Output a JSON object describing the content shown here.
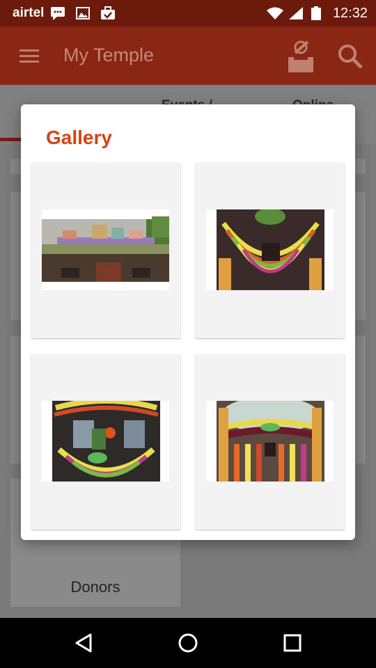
{
  "status_bar": {
    "carrier": "airtel",
    "time": "12:32",
    "icons": [
      "message-icon",
      "image-icon",
      "briefcase-check-icon",
      "wifi-icon",
      "signal-icon",
      "battery-icon"
    ]
  },
  "app_bar": {
    "title": "My Temple",
    "icons": [
      "menu-icon",
      "donation-box-icon",
      "search-icon"
    ]
  },
  "tabs": [
    "Events /",
    "Online"
  ],
  "donors": {
    "label": "Donors"
  },
  "dialog": {
    "title": "Gallery",
    "images": [
      {
        "name": "temple-exterior-photo"
      },
      {
        "name": "deity-garland-photo-1"
      },
      {
        "name": "deity-garland-photo-2"
      },
      {
        "name": "deity-garland-photo-3"
      }
    ]
  },
  "nav_bar": {
    "icons": [
      "back-icon",
      "home-icon",
      "recents-icon"
    ]
  },
  "colors": {
    "status_bar": "#6b1a0c",
    "app_bar": "#8a2614",
    "accent": "#d64416",
    "dialog_bg": "#ffffff",
    "cell_bg": "#f3f3f3"
  }
}
